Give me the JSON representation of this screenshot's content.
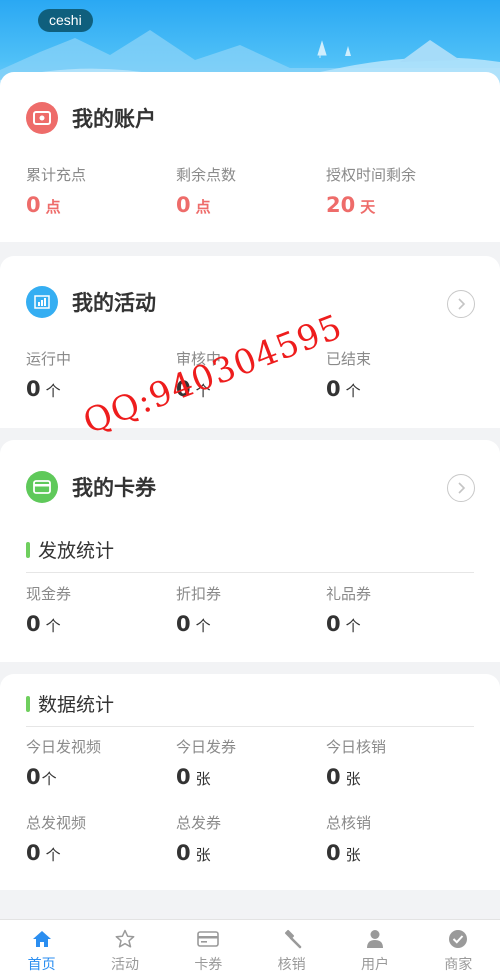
{
  "header": {
    "username": "ceshi"
  },
  "account": {
    "title": "我的账户",
    "stats": [
      {
        "label": "累计充点",
        "value": "0",
        "unit": "点"
      },
      {
        "label": "剩余点数",
        "value": "0",
        "unit": "点"
      },
      {
        "label": "授权时间剩余",
        "value": "20",
        "unit": "天"
      }
    ]
  },
  "activity": {
    "title": "我的活动",
    "stats": [
      {
        "label": "运行中",
        "value": "0",
        "unit": "个"
      },
      {
        "label": "审核中",
        "value": "0",
        "unit": "个"
      },
      {
        "label": "已结束",
        "value": "0",
        "unit": "个"
      }
    ]
  },
  "cards": {
    "title": "我的卡券",
    "issue_title": "发放统计",
    "issue_stats": [
      {
        "label": "现金券",
        "value": "0",
        "unit": "个"
      },
      {
        "label": "折扣券",
        "value": "0",
        "unit": "个"
      },
      {
        "label": "礼品券",
        "value": "0",
        "unit": "个"
      }
    ]
  },
  "data_stats": {
    "title": "数据统计",
    "row1": [
      {
        "label": "今日发视频",
        "value": "0",
        "unit": "个"
      },
      {
        "label": "今日发券",
        "value": "0",
        "unit": "张"
      },
      {
        "label": "今日核销",
        "value": "0",
        "unit": "张"
      }
    ],
    "row2": [
      {
        "label": "总发视频",
        "value": "0",
        "unit": "个"
      },
      {
        "label": "总发券",
        "value": "0",
        "unit": "张"
      },
      {
        "label": "总核销",
        "value": "0",
        "unit": "张"
      }
    ]
  },
  "watermark": "QQ:940304595",
  "tabbar": {
    "items": [
      {
        "label": "首页",
        "icon": "home-icon"
      },
      {
        "label": "活动",
        "icon": "star-icon"
      },
      {
        "label": "卡券",
        "icon": "card-icon"
      },
      {
        "label": "核销",
        "icon": "gavel-icon"
      },
      {
        "label": "用户",
        "icon": "user-icon"
      },
      {
        "label": "商家",
        "icon": "check-circle-icon"
      }
    ],
    "active_color": "#2b8ef0",
    "inactive_color": "#9a9a9a"
  },
  "colors": {
    "accent_red": "#ee6c6a",
    "accent_blue": "#2aa8f3",
    "accent_green": "#6fcf5e"
  }
}
